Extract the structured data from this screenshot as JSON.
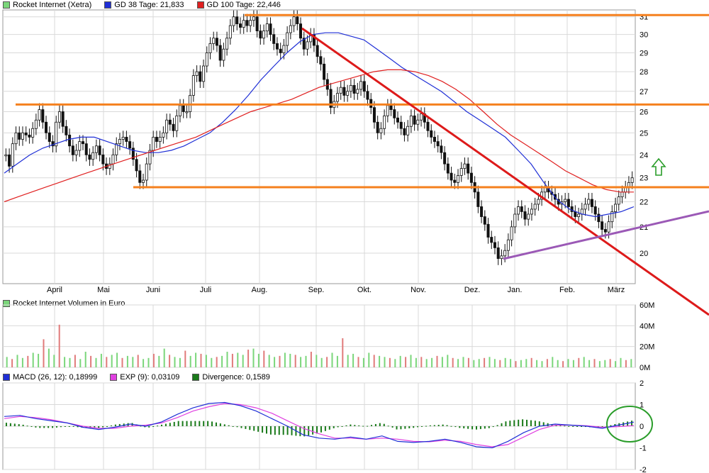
{
  "colors": {
    "up": "#ffffff",
    "down": "#111111",
    "wick": "#111111",
    "gd38": "#1f2fd6",
    "gd100": "#e02020",
    "orange": "#f5801e",
    "red_line": "#dd1a1a",
    "purple": "#9b59b6",
    "arrow": "#2a9d2a",
    "grid": "#d9d9d9",
    "vol_up": "#7ad67a",
    "vol_down": "#e07a7a",
    "macd": "#1f2fd6",
    "exp": "#e040e0",
    "hist": "#1a7a1a",
    "circle": "#2a9d2a"
  },
  "legends": {
    "main": [
      {
        "label": "Rocket Internet (Xetra)",
        "color": "#7ad67a"
      },
      {
        "label": "GD 38 Tage: 21,833",
        "color": "#1f2fd6"
      },
      {
        "label": "GD 100 Tage: 22,446",
        "color": "#e02020"
      }
    ],
    "volume": {
      "label": "Rocket Internet Volumen in Euro",
      "color": "#7ad67a"
    },
    "macd": [
      {
        "label": "MACD (26, 12): 0,18999",
        "color": "#1f2fd6"
      },
      {
        "label": "EXP (9): 0,03109",
        "color": "#e040e0"
      },
      {
        "label": "Divergence: 0,1589",
        "color": "#1a7a1a"
      }
    ]
  },
  "chart_data": [
    {
      "type": "candlestick",
      "name": "price",
      "months": [
        "April",
        "Mai",
        "Juni",
        "Juli",
        "Aug.",
        "Sep.",
        "Okt.",
        "Nov.",
        "Dez.",
        "Jan.",
        "Feb.",
        "März"
      ],
      "y_ticks": [
        20,
        21,
        22,
        23,
        24,
        25,
        26,
        27,
        28,
        29,
        30,
        31
      ],
      "ylim": [
        18.9,
        31.4
      ],
      "scale": "log",
      "close": [
        24.0,
        23.5,
        24.5,
        25.0,
        24.7,
        25.0,
        24.9,
        24.8,
        25.2,
        25.6,
        26.1,
        25.5,
        25.0,
        24.6,
        24.4,
        25.5,
        26.0,
        25.3,
        24.9,
        24.4,
        24.0,
        24.2,
        24.6,
        24.5,
        24.0,
        23.8,
        24.1,
        24.4,
        24.0,
        23.6,
        23.4,
        23.6,
        24.0,
        24.5,
        24.7,
        24.8,
        24.6,
        24.3,
        23.8,
        23.3,
        22.8,
        22.9,
        23.6,
        24.2,
        24.8,
        24.6,
        24.8,
        25.0,
        25.6,
        25.4,
        25.1,
        25.8,
        26.3,
        26.0,
        26.0,
        26.8,
        27.8,
        28.0,
        27.5,
        28.3,
        29.0,
        29.5,
        29.8,
        29.4,
        28.6,
        29.2,
        29.8,
        30.5,
        31.0,
        30.6,
        30.4,
        30.8,
        30.5,
        30.8,
        31.0,
        30.2,
        29.8,
        30.2,
        30.6,
        30.0,
        29.5,
        29.2,
        29.0,
        29.4,
        30.1,
        30.5,
        31.0,
        30.6,
        29.8,
        29.2,
        29.6,
        30.0,
        29.4,
        28.8,
        28.4,
        27.6,
        27.1,
        26.2,
        26.5,
        26.9,
        27.2,
        26.8,
        27.0,
        27.3,
        26.9,
        27.1,
        27.5,
        27.0,
        26.6,
        26.2,
        25.5,
        25.0,
        25.2,
        25.8,
        26.3,
        26.1,
        25.7,
        25.5,
        25.2,
        24.9,
        25.3,
        25.8,
        25.4,
        25.6,
        25.9,
        25.5,
        25.1,
        24.8,
        24.6,
        24.4,
        24.1,
        23.6,
        23.2,
        22.9,
        22.8,
        23.1,
        23.4,
        23.6,
        23.2,
        22.8,
        22.4,
        21.8,
        21.4,
        21.1,
        20.6,
        20.4,
        20.2,
        19.8,
        19.9,
        20.1,
        20.5,
        21.0,
        21.5,
        21.8,
        21.6,
        21.3,
        21.5,
        21.7,
        21.9,
        22.1,
        22.4,
        22.6,
        22.4,
        22.3,
        22.1,
        21.9,
        22.0,
        22.1,
        21.8,
        21.6,
        21.4,
        21.5,
        21.7,
        21.9,
        22.1,
        21.8,
        21.5,
        21.2,
        20.9,
        20.8,
        21.2,
        21.6,
        21.9,
        22.2,
        22.4,
        22.6,
        22.8,
        23.0
      ]
    },
    {
      "type": "line",
      "name": "gd",
      "series": [
        {
          "name": "GD 38 Tage",
          "values": [
            23.2,
            23.6,
            24.0,
            24.3,
            24.5,
            24.7,
            24.8,
            24.8,
            24.6,
            24.4,
            24.2,
            24.1,
            24.1,
            24.2,
            24.4,
            24.7,
            25.0,
            25.5,
            26.1,
            26.8,
            27.6,
            28.3,
            29.0,
            29.6,
            30.0,
            30.1,
            30.1,
            29.9,
            29.7,
            29.2,
            28.7,
            28.2,
            27.8,
            27.4,
            27.0,
            26.5,
            26.0,
            25.6,
            25.2,
            24.8,
            24.2,
            23.6,
            22.8,
            22.1,
            21.7,
            21.5,
            21.4,
            21.5,
            21.6,
            21.8
          ]
        },
        {
          "name": "GD 100 Tage",
          "values": [
            22.0,
            22.2,
            22.4,
            22.6,
            22.8,
            23.0,
            23.2,
            23.4,
            23.6,
            23.8,
            24.0,
            24.2,
            24.4,
            24.6,
            24.8,
            25.1,
            25.4,
            25.7,
            26.0,
            26.2,
            26.4,
            26.6,
            26.9,
            27.2,
            27.4,
            27.6,
            27.8,
            28.0,
            28.1,
            28.1,
            28.0,
            27.8,
            27.5,
            27.1,
            26.6,
            26.0,
            25.4,
            24.9,
            24.5,
            24.1,
            23.7,
            23.3,
            23.0,
            22.7,
            22.5,
            22.4,
            22.4
          ]
        }
      ]
    },
    {
      "type": "bar",
      "name": "Rocket Internet Volumen in Euro",
      "y_ticks": [
        "0M",
        "20M",
        "40M",
        "60M"
      ],
      "ylim": [
        0,
        60
      ],
      "values": [
        10,
        8,
        12,
        9,
        11,
        14,
        13,
        27,
        18,
        12,
        41,
        10,
        9,
        12,
        8,
        15,
        11,
        9,
        13,
        10,
        12,
        14,
        9,
        11,
        10,
        12,
        8,
        9,
        13,
        11,
        18,
        12,
        10,
        9,
        16,
        11,
        14,
        13,
        12,
        9,
        10,
        11,
        15,
        13,
        14,
        12,
        17,
        18,
        13,
        16,
        12,
        10,
        11,
        14,
        13,
        12,
        10,
        11,
        15,
        12,
        9,
        10,
        14,
        11,
        28,
        12,
        13,
        10,
        9,
        14,
        12,
        11,
        10,
        9,
        8,
        11,
        10,
        12,
        9,
        10,
        8,
        9,
        11,
        10,
        12,
        9,
        8,
        10,
        9,
        7,
        8,
        9,
        10,
        8,
        7,
        9,
        8,
        6,
        7,
        8,
        9,
        7,
        6,
        8,
        10,
        7,
        6,
        8,
        7,
        9,
        10,
        7,
        8,
        6,
        7,
        8,
        6,
        9,
        7,
        8
      ]
    },
    {
      "type": "line",
      "name": "MACD",
      "y_ticks": [
        2,
        1,
        0,
        -1,
        -2
      ],
      "ylim": [
        -2,
        2
      ],
      "series": [
        {
          "name": "MACD (26, 12)",
          "values": [
            0.45,
            0.5,
            0.35,
            0.25,
            0.15,
            -0.05,
            -0.15,
            -0.05,
            0.1,
            0.0,
            0.2,
            0.55,
            0.85,
            1.05,
            1.1,
            0.95,
            0.7,
            0.35,
            0.0,
            -0.4,
            -0.55,
            -0.6,
            -0.5,
            -0.6,
            -0.45,
            -0.7,
            -0.75,
            -0.7,
            -0.6,
            -0.75,
            -0.95,
            -1.0,
            -0.7,
            -0.3,
            0.0,
            0.1,
            0.05,
            0.0,
            -0.1,
            0.05,
            0.19
          ]
        },
        {
          "name": "EXP (9)",
          "values": [
            0.35,
            0.45,
            0.4,
            0.3,
            0.15,
            0.0,
            -0.1,
            -0.1,
            0.0,
            0.05,
            0.15,
            0.4,
            0.7,
            0.9,
            1.05,
            1.0,
            0.85,
            0.6,
            0.25,
            -0.1,
            -0.35,
            -0.55,
            -0.55,
            -0.6,
            -0.55,
            -0.6,
            -0.7,
            -0.72,
            -0.65,
            -0.7,
            -0.85,
            -0.95,
            -0.85,
            -0.5,
            -0.15,
            0.05,
            0.05,
            0.02,
            -0.05,
            -0.02,
            0.03
          ]
        }
      ]
    }
  ]
}
